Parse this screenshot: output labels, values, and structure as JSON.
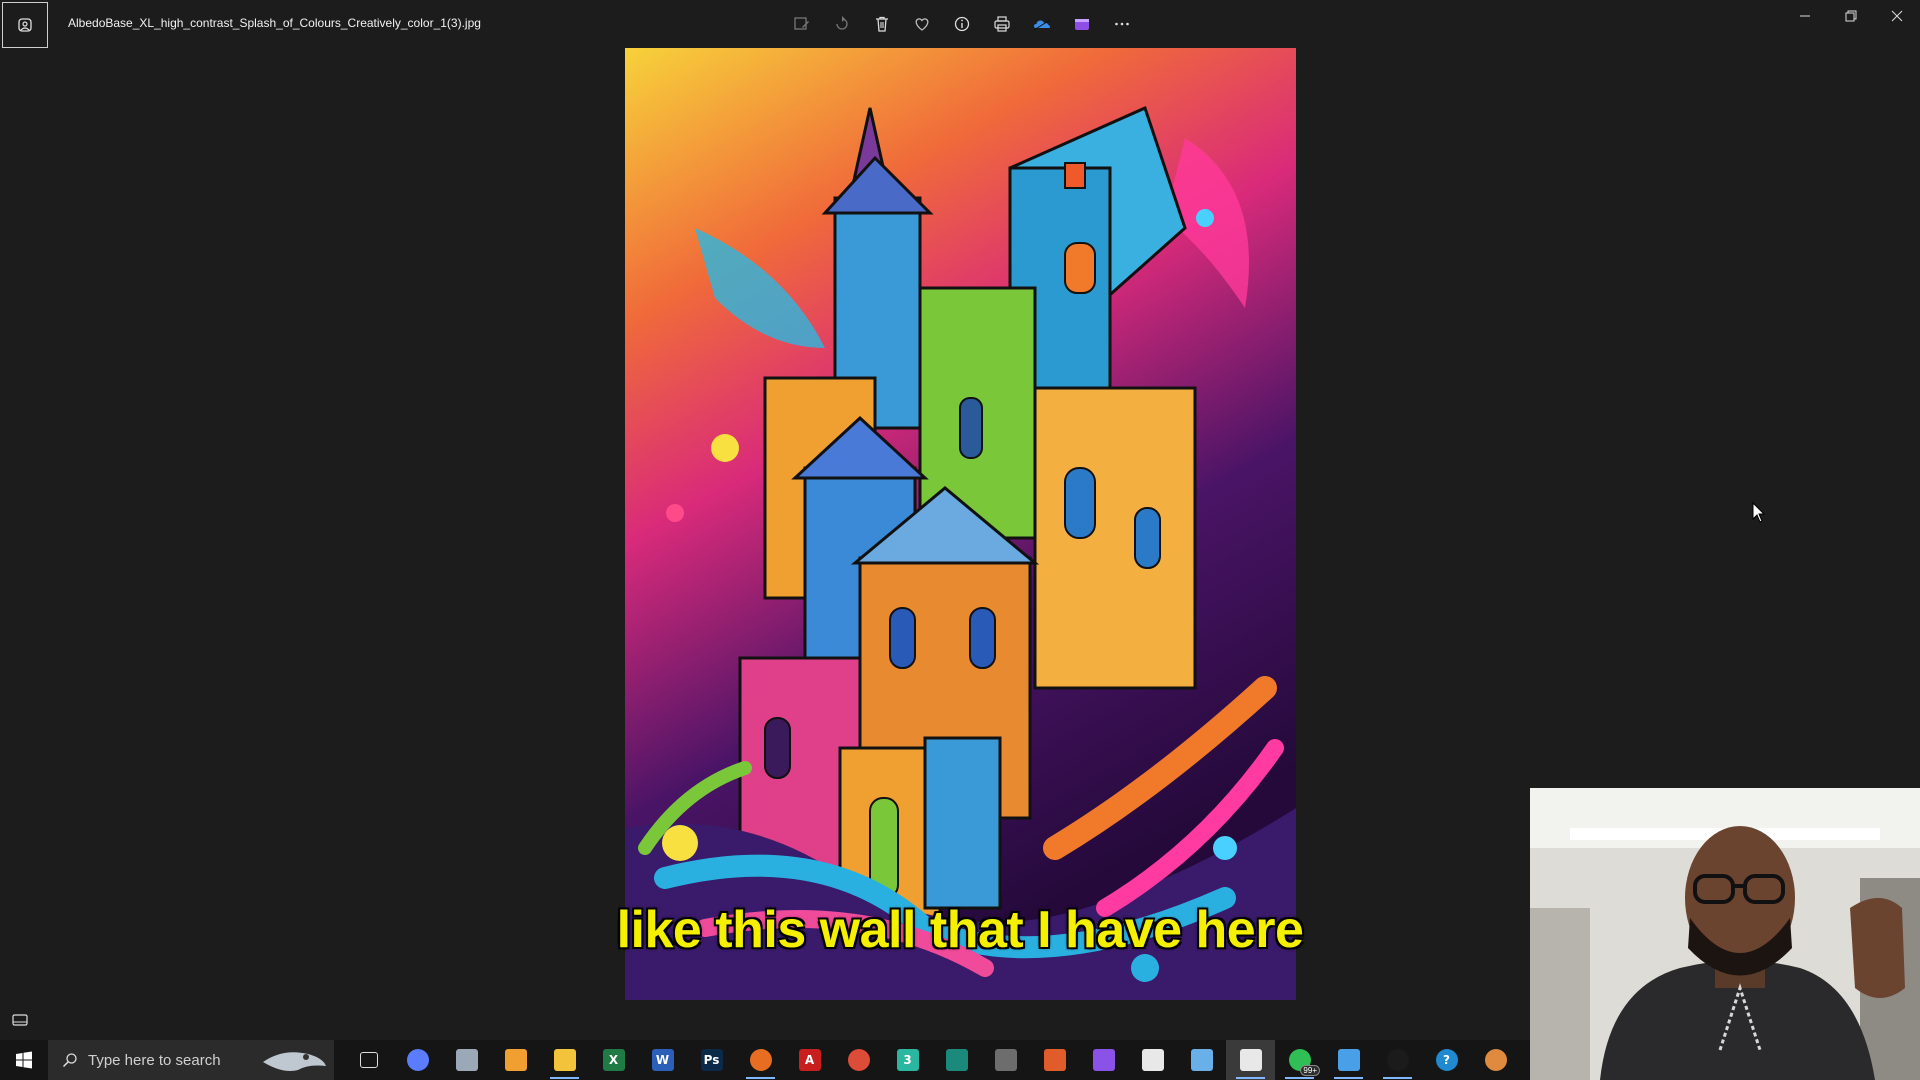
{
  "titlebar": {
    "file_name": "AlbedoBase_XL_high_contrast_Splash_of_Colours_Creatively_color_1(3).jpg",
    "toolbar": [
      {
        "name": "edit-image-icon"
      },
      {
        "name": "rotate-icon"
      },
      {
        "name": "delete-icon"
      },
      {
        "name": "favorite-heart-icon"
      },
      {
        "name": "info-icon"
      },
      {
        "name": "print-icon"
      },
      {
        "name": "onedrive-cloud-icon"
      },
      {
        "name": "clipchamp-video-icon"
      },
      {
        "name": "more-options-icon"
      }
    ],
    "window_controls": [
      "minimize-icon",
      "restore-icon",
      "close-icon"
    ]
  },
  "caption": "like this wall that I have here",
  "taskbar": {
    "search_placeholder": "Type here to search",
    "apps": [
      {
        "name": "task-view-icon",
        "glyph": "",
        "color": "#151515"
      },
      {
        "name": "copilot-icon",
        "glyph": "",
        "color": "#5b7cff"
      },
      {
        "name": "paint-icon",
        "glyph": "",
        "color": "#9aa8b8"
      },
      {
        "name": "media-player-icon",
        "glyph": "",
        "color": "#f0a030"
      },
      {
        "name": "file-explorer-icon",
        "glyph": "",
        "color": "#f3c33b"
      },
      {
        "name": "excel-icon",
        "glyph": "X",
        "color": "#1f7a44"
      },
      {
        "name": "word-icon",
        "glyph": "W",
        "color": "#2b5fb8"
      },
      {
        "name": "photoshop-icon",
        "glyph": "Ps",
        "color": "#0b2a4a"
      },
      {
        "name": "firefox-icon",
        "glyph": "",
        "color": "#e66d21"
      },
      {
        "name": "acrobat-icon",
        "glyph": "A",
        "color": "#c81e1e"
      },
      {
        "name": "chrome-icon",
        "glyph": "",
        "color": "#dd4b39"
      },
      {
        "name": "app-3-icon",
        "glyph": "3",
        "color": "#2ab69f"
      },
      {
        "name": "terminal-app-icon",
        "glyph": "",
        "color": "#1b8a7a"
      },
      {
        "name": "calculator-icon",
        "glyph": "",
        "color": "#6d6d6d"
      },
      {
        "name": "app-dot-icon",
        "glyph": "",
        "color": "#e05c2a"
      },
      {
        "name": "clipchamp-icon",
        "glyph": "",
        "color": "#8a52e6"
      },
      {
        "name": "capcut-icon",
        "glyph": "",
        "color": "#e8e8e8"
      },
      {
        "name": "notepad-icon",
        "glyph": "",
        "color": "#6ab0e8"
      },
      {
        "name": "capcut-active-icon",
        "glyph": "",
        "color": "#e8e8e8"
      },
      {
        "name": "whatsapp-icon",
        "glyph": "",
        "color": "#2fbf55",
        "badge": "99+"
      },
      {
        "name": "photos-icon",
        "glyph": "",
        "color": "#4aa0e8"
      },
      {
        "name": "clock-app-icon",
        "glyph": "",
        "color": "#1b1b1b"
      },
      {
        "name": "help-icon",
        "glyph": "?",
        "color": "#1f8ad0"
      },
      {
        "name": "user-app-icon",
        "glyph": "",
        "color": "#e08a40"
      }
    ]
  }
}
